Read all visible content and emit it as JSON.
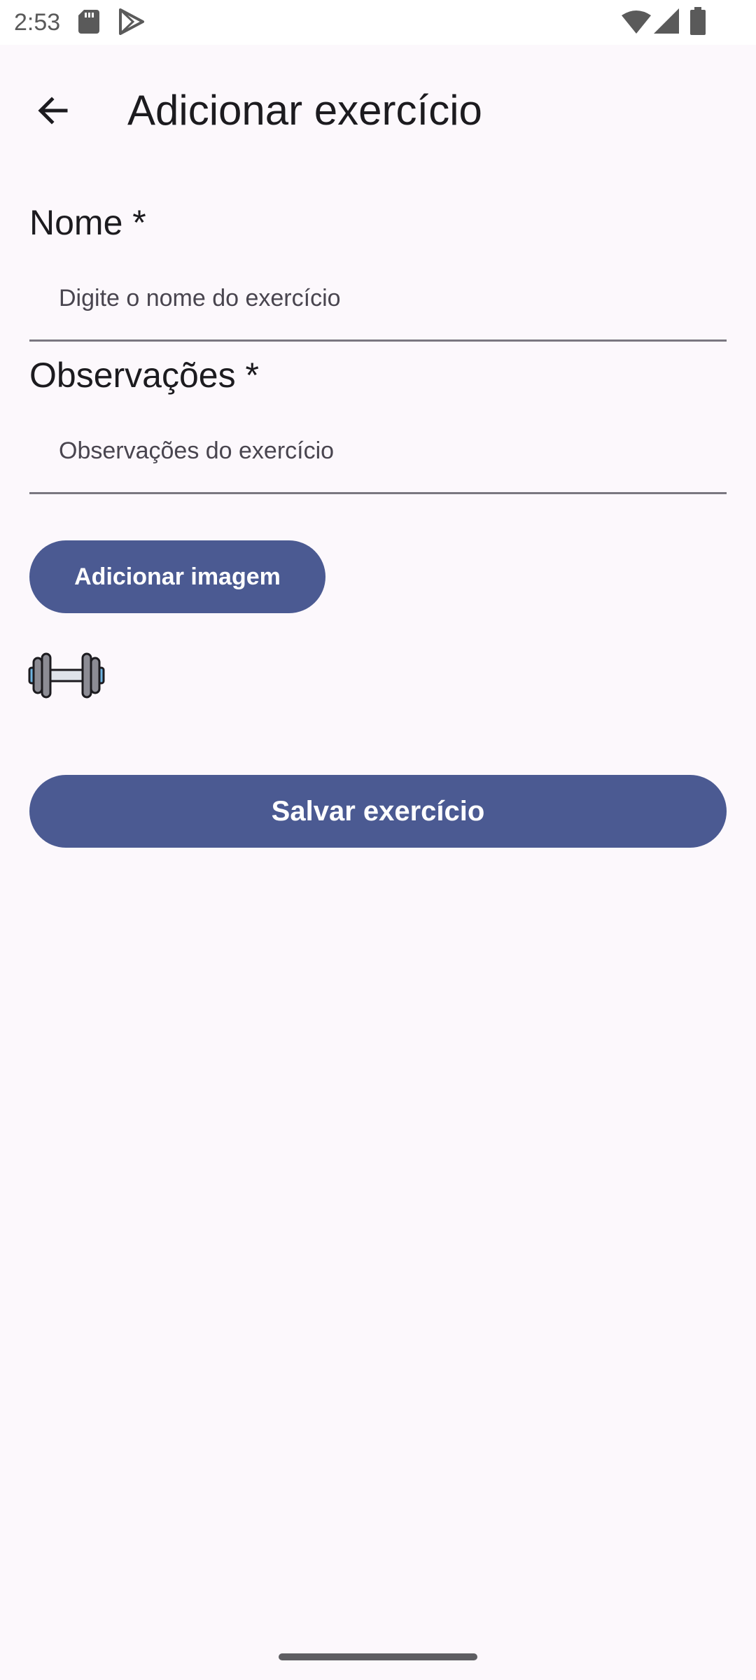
{
  "status_bar": {
    "time": "2:53",
    "icons_left": [
      "sd-card-icon",
      "play-store-icon"
    ],
    "icons_right": [
      "wifi-icon",
      "signal-icon",
      "battery-icon"
    ]
  },
  "app_bar": {
    "title": "Adicionar exercício",
    "back_icon": "arrow-back-icon"
  },
  "form": {
    "name_label": "Nome *",
    "name_placeholder": "Digite o nome do exercício",
    "name_value": "",
    "notes_label": "Observações *",
    "notes_placeholder": "Observações do exercício",
    "notes_value": "",
    "add_image_label": "Adicionar imagem",
    "image_preview_icon": "dumbbell-icon",
    "save_label": "Salvar exercício"
  },
  "colors": {
    "primary": "#4b5a92",
    "background": "#fcf8fc",
    "on_surface": "#1c1b1f",
    "outline": "#7a7780"
  }
}
